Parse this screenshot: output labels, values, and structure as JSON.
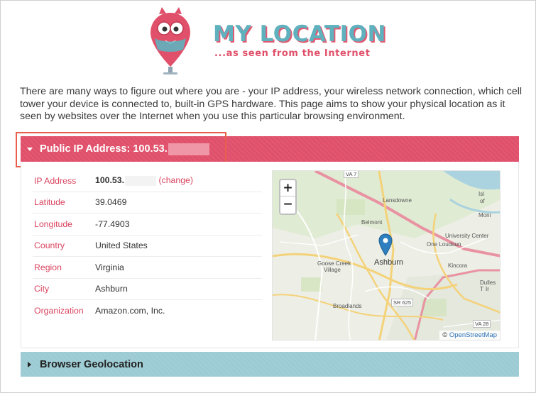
{
  "header": {
    "title": "MY LOCATION",
    "tagline": "...as seen from the Internet"
  },
  "intro": "There are many ways to figure out where you are - your IP address, your wireless network connection, which cell tower your device is connected to, built-in GPS hardware. This page aims to show your physical location as it seen by websites over the Internet when you use this particular browsing environment.",
  "ip_panel": {
    "header_label": "Public IP Address: 100.53.",
    "rows": [
      {
        "key": "IP Address",
        "value": "100.53.",
        "link": "(change)"
      },
      {
        "key": "Latitude",
        "value": "39.0469"
      },
      {
        "key": "Longitude",
        "value": "-77.4903"
      },
      {
        "key": "Country",
        "value": "United States"
      },
      {
        "key": "Region",
        "value": "Virginia"
      },
      {
        "key": "City",
        "value": "Ashburn"
      },
      {
        "key": "Organization",
        "value": "Amazon.com, Inc."
      }
    ]
  },
  "map": {
    "zoom_in": "+",
    "zoom_out": "−",
    "attribution_symbol": "©",
    "attribution_link": "OpenStreetMap",
    "labels": {
      "ashburn": "Ashburn",
      "lansdowne": "Lansdowne",
      "belmont": "Belmont",
      "university_center": "University Center",
      "one_loudoun": "One Loudoun",
      "goose_creek_1": "Goose Creek",
      "goose_creek_2": "Village",
      "kincora": "Kincora",
      "dulles_1": "Dulles T",
      "dulles_2": "Ir",
      "broadlands": "Broadlands",
      "isl": "Isl",
      "of": "of",
      "moni": "Moni",
      "va7": "VA 7",
      "sr625": "SR 625",
      "va28": "VA 28"
    }
  },
  "geo_panel": {
    "header_label": "Browser Geolocation"
  },
  "colors": {
    "accent_red": "#e0506a",
    "accent_teal": "#9ccbd3",
    "link": "#d9445f"
  }
}
